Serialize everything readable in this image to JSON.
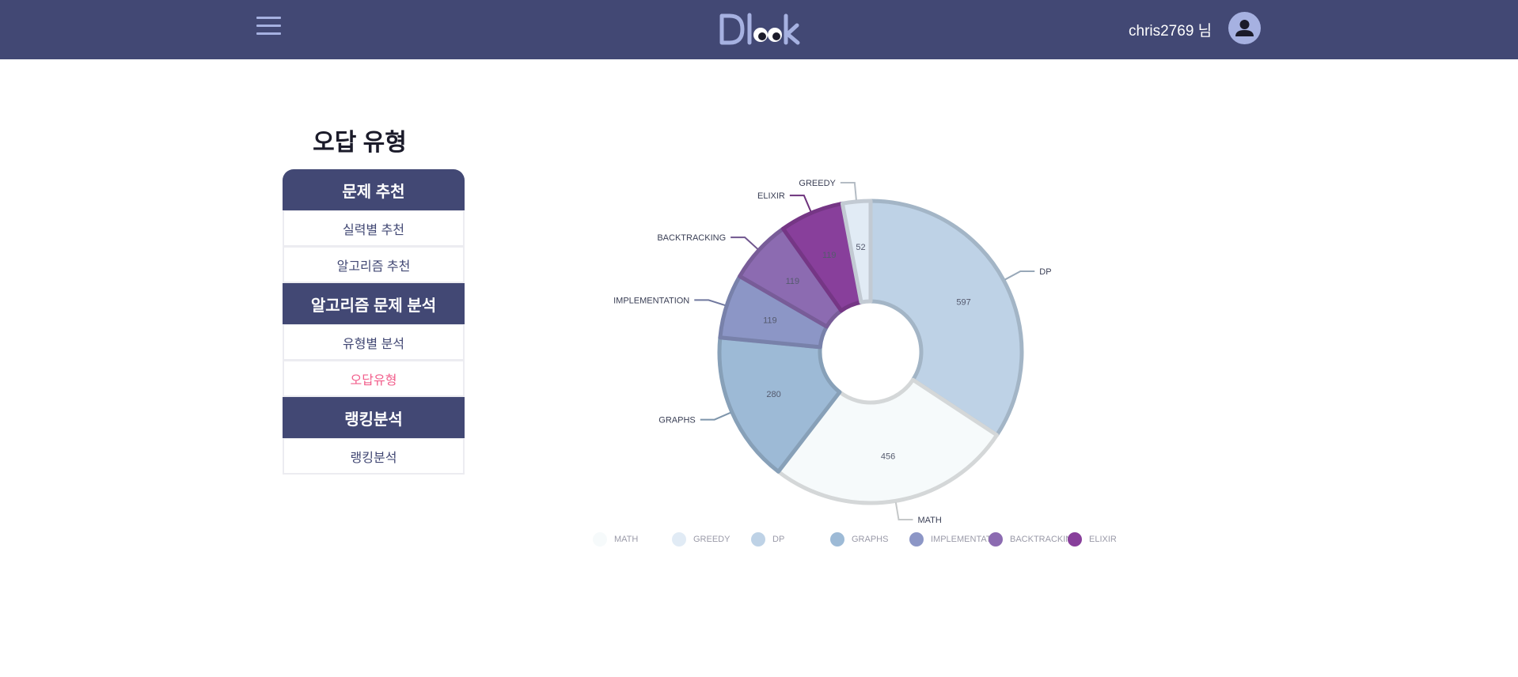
{
  "header": {
    "username": "chris2769 님",
    "logo_text": "Dlook",
    "colors": {
      "bar": "#424874",
      "accent": "#a6b1e1"
    }
  },
  "sidebar": {
    "page_title": "오답 유형",
    "sections": [
      {
        "title": "문제 추천",
        "items": [
          {
            "label": "실력별 추천",
            "active": false
          },
          {
            "label": "알고리즘 추천",
            "active": false
          }
        ]
      },
      {
        "title": "알고리즘 문제 분석",
        "items": [
          {
            "label": "유형별 분석",
            "active": false
          },
          {
            "label": "오답유형",
            "active": true
          }
        ]
      },
      {
        "title": "랭킹분석",
        "items": [
          {
            "label": "랭킹분석",
            "active": false
          }
        ]
      }
    ],
    "colors": {
      "active_text": "#f25f8c"
    }
  },
  "chart_data": {
    "type": "pie",
    "variant": "donut",
    "legend_position": "bottom",
    "slices": [
      {
        "label": "DP",
        "value": 597,
        "color": "#bed2e6"
      },
      {
        "label": "MATH",
        "value": 456,
        "color": "#f6fafb"
      },
      {
        "label": "GRAPHS",
        "value": 280,
        "color": "#9dbad6"
      },
      {
        "label": "IMPLEMENTATION",
        "value": 119,
        "color": "#8c96c6"
      },
      {
        "label": "BACKTRACKING",
        "value": 119,
        "color": "#8c6bb1"
      },
      {
        "label": "ELIXIR",
        "value": 119,
        "color": "#883f9b"
      },
      {
        "label": "GREEDY",
        "value": 52,
        "color": "#e1ebf5"
      }
    ],
    "legend": [
      {
        "label": "MATH",
        "color": "#f6fafb"
      },
      {
        "label": "GREEDY",
        "color": "#e1ebf5"
      },
      {
        "label": "DP",
        "color": "#bed2e6"
      },
      {
        "label": "GRAPHS",
        "color": "#9dbad6"
      },
      {
        "label": "IMPLEMENTATION",
        "color": "#8c96c6"
      },
      {
        "label": "BACKTRACKING",
        "color": "#8c6bb1"
      },
      {
        "label": "ELIXIR",
        "color": "#883f9b"
      }
    ]
  }
}
